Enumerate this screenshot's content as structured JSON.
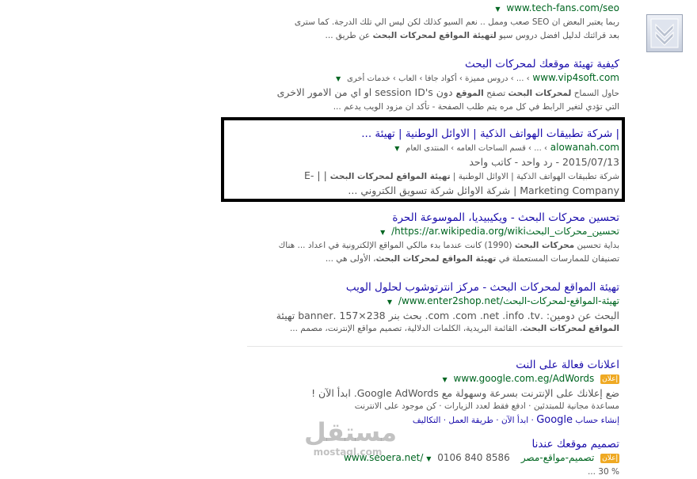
{
  "results": [
    {
      "url": "www.tech-fans.com/seo",
      "snippet1": "ربما يعتبر البعض ان SEO صعب وممل .. نعم السيو كذلك لكن ليس الي تلك الدرجة. كما سترى",
      "snippet2_pre": "بعد قرائتك لدليل افضل دروس سيو ",
      "snippet2_bold": "لتهيئة المواقع لمحركات البحث",
      "snippet2_post": " عن طريق ..."
    },
    {
      "title": "كيفية تهيئة موقعك لمحركات البحث",
      "url": "www.vip4soft.com",
      "breadcrumb": "› ... › دروس مميزة › أكواد جافا › العاب › خدمات أخرى",
      "snippet1_pre": "حاول السماح ",
      "snippet1_b1": "لمحركات البحث",
      "snippet1_mid": " تصفح ",
      "snippet1_b2": "الموقع",
      "snippet1_post": " دون session ID's او اي من الامور الاخرى",
      "snippet2": "التي تؤدي لتغير الرابط في كل مره يتم طلب الصفحة - تأكد ان مزود الويب يدعم ..."
    },
    {
      "title": "| شركة تطبيقات الهواتف الذكية | الاوائل الوطنية | تهيئة ...",
      "url": "alowanah.com",
      "breadcrumb": "› ... › قسم الساحات العامه › المنتدى العام",
      "meta": "2015/07/13 - رد واحد - كاتب واحد",
      "snippet1_pre": "شركة تطبيقات الهواتف الذكية | الاوائل الوطنية | ",
      "snippet1_bold": "تهيئة المواقع لمحركات البحث",
      "snippet1_post": " | | -E",
      "snippet2": "Marketing Company | شركة الاوائل شركة تسويق الكتروني ..."
    },
    {
      "title": "تحسين محركات البحث - ويكيبيديا، الموسوعة الحرة",
      "url": "https://ar.wikipedia.org/wiki/",
      "url_suffix": "تحسين_محركات_البحث",
      "snippet1_pre": "بداية تحسين ",
      "snippet1_bold": "محركات البحث",
      "snippet1_post": " (1990) كانت عندما بدء مالكي المواقع الإلكترونية في اعداد ... هناك",
      "snippet2_pre": "تصنيفان للممارسات المستعملة في ",
      "snippet2_bold": "تهيئة المواقع لمحركات البحث",
      "snippet2_post": "، الأولى هي ..."
    },
    {
      "title": "تهيئة المواقع لمحركات البحث - مركز انترتوشوب لحلول الويب",
      "url": "www.enter2shop.net/",
      "url_suffix": "تهيئة-المواقع-لمحركات-البحث/",
      "snippet1": "البحث عن دومين: .com .com .net .info .tv. بحث بنر 238×157 .banner تهيئة",
      "snippet2_pre": "",
      "snippet2_bold": "المواقع لمحركات البحث",
      "snippet2_post": "، القائمة البريدية، الكلمات الدلالية، تصميم مواقع الإنترنت، مصمم ..."
    }
  ],
  "ads": [
    {
      "title": "اعلانات فعالة على النت",
      "badge": "إعلان",
      "url": "www.google.com.eg/AdWords",
      "line1": "ضع إعلانك على الإنترنت بسرعة وسهولة مع Google AdWords. ابدأ الآن !",
      "line2": "مساعدة مجانية للمبتدئين · ادفع فقط لعدد الزيارات · كن موجود على الانترنت",
      "links_pre": "إنشاء حساب ",
      "links_google": "Google",
      "links_post": " · ابدأ الآن · طريقة العمل · التكاليف"
    },
    {
      "title": "تصميم موقعك عندنا",
      "badge": "إعلان",
      "url": "www.seoera.net/",
      "url_suffix": "تصميم-مواقع-مصر",
      "phone": "0106 840 8586",
      "line1": "% 30 ..."
    }
  ],
  "watermark": {
    "arabic": "مستقل",
    "latin": "mostaql.com"
  },
  "icons": {
    "scroll": "double-chevron-down-icon",
    "dropdown": "caret-down-icon"
  },
  "colors": {
    "link": "#1a0dab",
    "url": "#006621",
    "text": "#545454",
    "ad": "#efa923",
    "highlight": "#000000"
  }
}
